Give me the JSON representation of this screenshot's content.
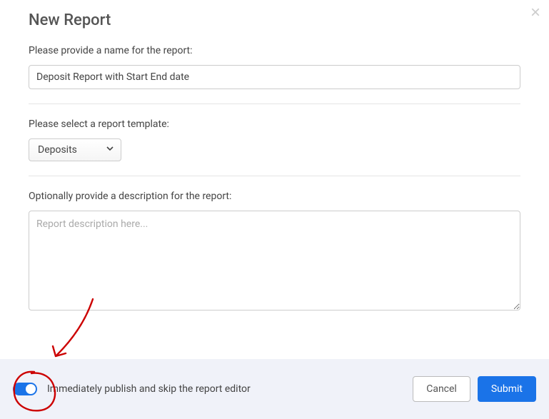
{
  "modal": {
    "title": "New Report",
    "close_label": "×"
  },
  "name_section": {
    "label": "Please provide a name for the report:",
    "value": "Deposit Report with Start End date"
  },
  "template_section": {
    "label": "Please select a report template:",
    "selected": "Deposits"
  },
  "description_section": {
    "label": "Optionally provide a description for the report:",
    "placeholder": "Report description here...",
    "value": ""
  },
  "footer": {
    "toggle_label": "Immediately publish and skip the report editor",
    "toggle_on": true,
    "cancel_label": "Cancel",
    "submit_label": "Submit"
  },
  "annotation": {
    "color": "#cc0000"
  }
}
